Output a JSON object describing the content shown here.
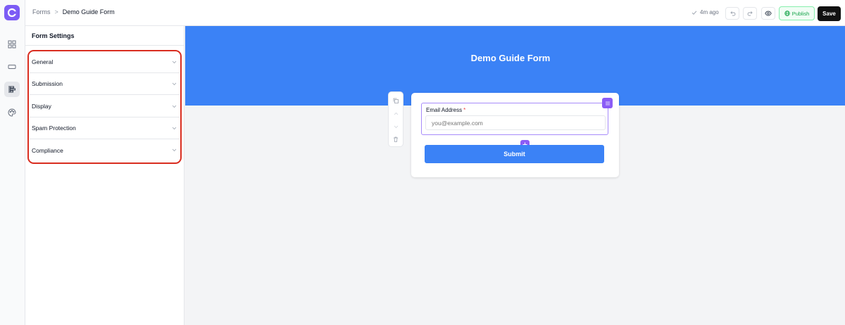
{
  "breadcrumb": {
    "root": "Forms",
    "separator": ">",
    "current": "Demo Guide Form"
  },
  "toolbar": {
    "saved_status": "4m ago",
    "publish_label": "Publish",
    "save_label": "Save"
  },
  "settings_panel": {
    "title": "Form Settings",
    "sections": [
      {
        "label": "General"
      },
      {
        "label": "Submission"
      },
      {
        "label": "Display"
      },
      {
        "label": "Spam Protection"
      },
      {
        "label": "Compliance"
      }
    ]
  },
  "form": {
    "title": "Demo Guide Form",
    "fields": [
      {
        "label": "Email Address",
        "required_mark": "*",
        "placeholder": "you@example.com"
      }
    ],
    "submit_label": "Submit"
  },
  "colors": {
    "accent": "#7c5cf5",
    "hero": "#3b82f6",
    "highlight": "#d92d20",
    "publish": "#16a34a"
  }
}
